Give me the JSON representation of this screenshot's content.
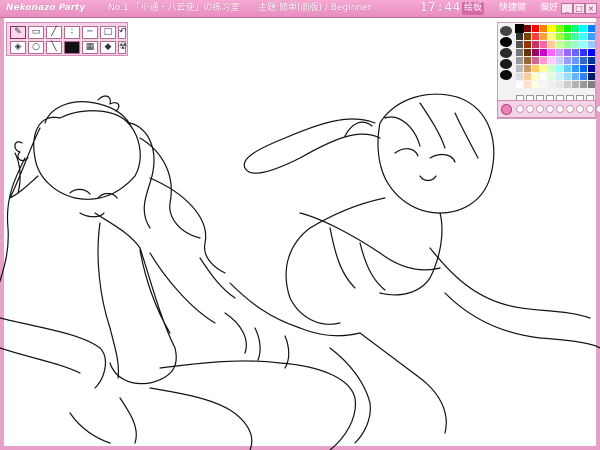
{
  "titlebar": {
    "app_title": "Nekonazo Party",
    "room": "No.1 「小通・八云使」の练习室",
    "topic": "主題:簡単(画版) / Beginner",
    "clock": "17:44"
  },
  "menu": [
    {
      "label": "绘板",
      "active": true
    },
    {
      "label": "快捷键",
      "active": false
    },
    {
      "label": "偏好",
      "active": false
    }
  ],
  "window_buttons": [
    "_",
    "□",
    "×"
  ],
  "toolbox": {
    "row1": [
      "pencil-icon",
      "eraser-icon",
      "brush-icon",
      "airbrush-icon",
      "line-icon",
      "rect-icon",
      "move-icon",
      "clear-icon"
    ],
    "row2": [
      "fill-icon",
      "lasso-icon",
      "pen-icon",
      "color-swatch-icon",
      "select-icon",
      "stamp-icon",
      "undo-icon",
      "radiation-icon"
    ]
  },
  "palette": {
    "selected_color": "#000000",
    "side_colors": [
      "#444444",
      "#000000",
      "#2a2a2a",
      "#1a1a1a",
      "#0a0a0a"
    ],
    "grid_colors": [
      "#000000",
      "#7f0000",
      "#ff0000",
      "#ff7f00",
      "#ffff00",
      "#7fff00",
      "#00ff00",
      "#00ff7f",
      "#00ffff",
      "#007fff",
      "#333333",
      "#7f3f00",
      "#ff3f3f",
      "#ff9f3f",
      "#ffff7f",
      "#9fff3f",
      "#3fff3f",
      "#3fff9f",
      "#3fffff",
      "#3f9fff",
      "#555555",
      "#993300",
      "#cc3366",
      "#ff6699",
      "#ffcc99",
      "#ccff99",
      "#99ff99",
      "#99ffcc",
      "#99ffff",
      "#99ccff",
      "#777777",
      "#663300",
      "#990066",
      "#cc00cc",
      "#ff66ff",
      "#cc99ff",
      "#9966ff",
      "#6666ff",
      "#3333ff",
      "#0000ff",
      "#999999",
      "#996633",
      "#cc6699",
      "#ff99cc",
      "#ffccff",
      "#ccccff",
      "#9999ff",
      "#6699ff",
      "#3366cc",
      "#003399",
      "#bbbbbb",
      "#cc9966",
      "#ffcc66",
      "#ffff99",
      "#ccffcc",
      "#99ffff",
      "#66ccff",
      "#3399ff",
      "#0066ff",
      "#000099",
      "#dddddd",
      "#ffcc99",
      "#ffffcc",
      "#ffffff",
      "#e0ffe0",
      "#ccf0ff",
      "#99ddff",
      "#66b3ff",
      "#3380ff",
      "#001a66",
      "#ffffff",
      "#ffe0cc",
      "#ffffe6",
      "#f7f7f7",
      "#eeeeee",
      "#e6e6e6",
      "#cccccc",
      "#b3b3b3",
      "#999999",
      "#808080"
    ],
    "custom_slots": 8
  },
  "strip_slots": 11
}
